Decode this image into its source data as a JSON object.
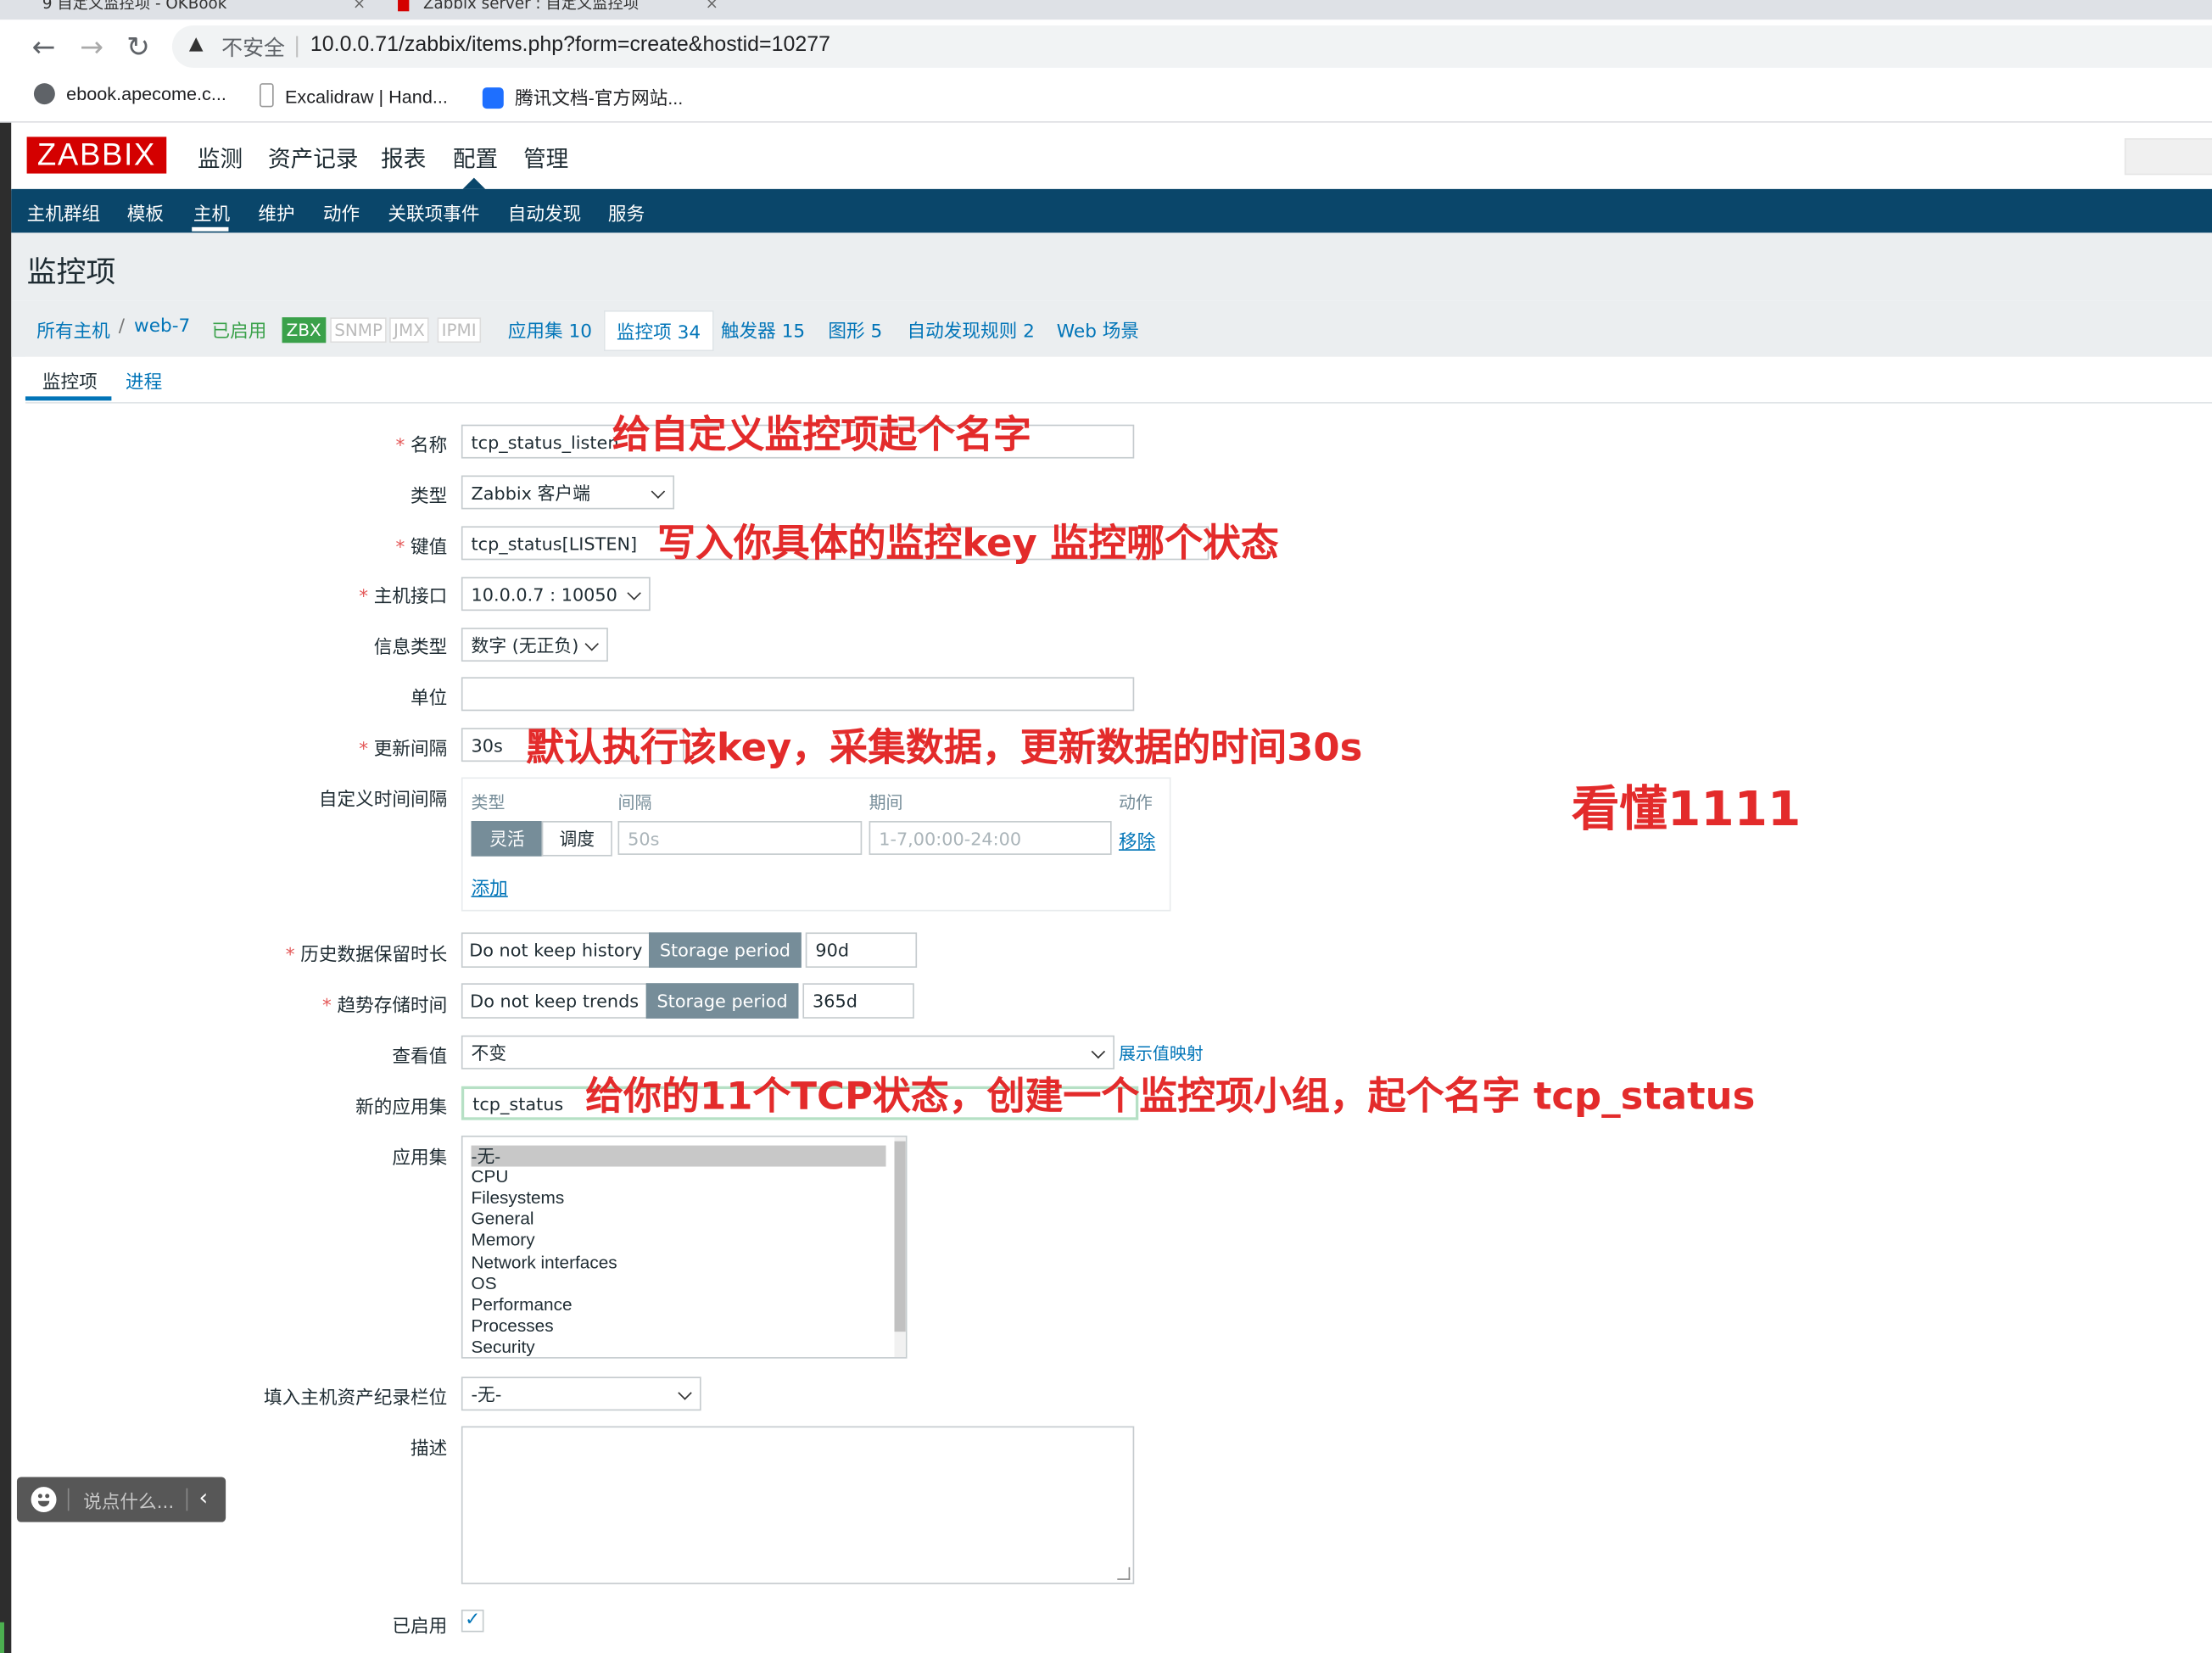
{
  "browser": {
    "tab_fragments": [
      "9  自定义监控项 - OKBook",
      "Zabbix server : 自定义监控项"
    ],
    "not_secure": "不安全",
    "url": "10.0.0.71/zabbix/items.php?form=create&hostid=10277",
    "bookmarks": [
      "ebook.apecome.c...",
      "Excalidraw | Hand...",
      "腾讯文档-官方网站..."
    ]
  },
  "zabbix": {
    "logo": "ZABBIX",
    "main_menu": [
      "监测",
      "资产记录",
      "报表",
      "配置",
      "管理"
    ],
    "sub_menu": [
      "主机群组",
      "模板",
      "主机",
      "维护",
      "动作",
      "关联项事件",
      "自动发现",
      "服务"
    ],
    "page_title": "监控项",
    "breadcrumb": {
      "all_hosts": "所有主机",
      "sep": "/",
      "host": "web-7",
      "enabled": "已启用",
      "interfaces": [
        "ZBX",
        "SNMP",
        "JMX",
        "IPMI"
      ],
      "links": [
        "应用集 10",
        "监控项 34",
        "触发器 15",
        "图形 5",
        "自动发现规则 2",
        "Web 场景"
      ]
    },
    "form_tabs": [
      "监控项",
      "进程"
    ]
  },
  "form": {
    "name": {
      "label": "名称",
      "value": "tcp_status_listen"
    },
    "type": {
      "label": "类型",
      "value": "Zabbix 客户端"
    },
    "key": {
      "label": "键值",
      "value": "tcp_status[LISTEN]"
    },
    "interface": {
      "label": "主机接口",
      "value": "10.0.0.7 : 10050"
    },
    "info_type": {
      "label": "信息类型",
      "value": "数字 (无正负)"
    },
    "units": {
      "label": "单位",
      "value": ""
    },
    "interval": {
      "label": "更新间隔",
      "value": "30s"
    },
    "custom_intervals": {
      "label": "自定义时间间隔",
      "headers": [
        "类型",
        "间隔",
        "期间",
        "动作"
      ],
      "seg_flexible": "灵活",
      "seg_scheduling": "调度",
      "interval_placeholder": "50s",
      "period_placeholder": "1-7,00:00-24:00",
      "remove": "移除",
      "add": "添加"
    },
    "history": {
      "label": "历史数据保留时长",
      "opt_off": "Do not keep history",
      "opt_on": "Storage period",
      "value": "90d"
    },
    "trends": {
      "label": "趋势存储时间",
      "opt_off": "Do not keep trends",
      "opt_on": "Storage period",
      "value": "365d"
    },
    "valuemap": {
      "label": "查看值",
      "value": "不变",
      "link": "展示值映射"
    },
    "new_app": {
      "label": "新的应用集",
      "value": "tcp_status"
    },
    "apps": {
      "label": "应用集",
      "options": [
        "-无-",
        "CPU",
        "Filesystems",
        "General",
        "Memory",
        "Network interfaces",
        "OS",
        "Performance",
        "Processes",
        "Security"
      ]
    },
    "inventory": {
      "label": "填入主机资产纪录栏位",
      "value": "-无-"
    },
    "description": {
      "label": "描述",
      "value": ""
    },
    "enabled": {
      "label": "已启用",
      "checked": true
    }
  },
  "annotations": {
    "name_note": "给自定义监控项起个名字",
    "key_note": "写入你具体的监控key 监控哪个状态",
    "interval_note": "默认执行该key，采集数据，更新数据的时间30s",
    "understood_note": "看懂1111",
    "app_note": "给你的11个TCP状态，创建一个监控项小组，起个名字  tcp_status"
  },
  "chat_widget": {
    "placeholder": "说点什么..."
  },
  "colors": {
    "zabbix_red": "#d40000",
    "nav_blue": "#0a466a",
    "link_blue": "#0275b8",
    "annotation_red": "#e32b2b",
    "enabled_green": "#3aa14a"
  }
}
